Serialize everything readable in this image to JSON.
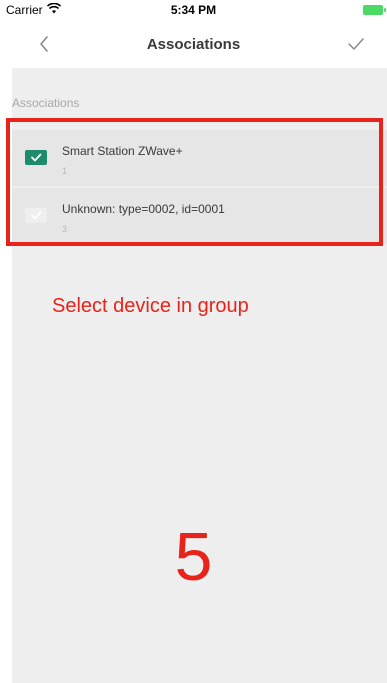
{
  "status_bar": {
    "carrier": "Carrier",
    "time": "5:34 PM",
    "wifi_icon": "wifi-icon",
    "battery_icon": "battery-charging-icon"
  },
  "nav": {
    "back_icon": "chevron-left-icon",
    "title": "Associations",
    "done_icon": "checkmark-icon"
  },
  "section": {
    "header": "Associations"
  },
  "devices": [
    {
      "name": "Smart Station ZWave+",
      "id": "1",
      "selected": true
    },
    {
      "name": "Unknown: type=0002, id=0001",
      "id": "3",
      "selected": false
    }
  ],
  "annotations": {
    "text": "Select device in group",
    "number": "5",
    "color": "#e8231a"
  },
  "colors": {
    "accent": "#1e8c6c",
    "background": "#eeeeee",
    "row_background": "#e6e6e6"
  }
}
